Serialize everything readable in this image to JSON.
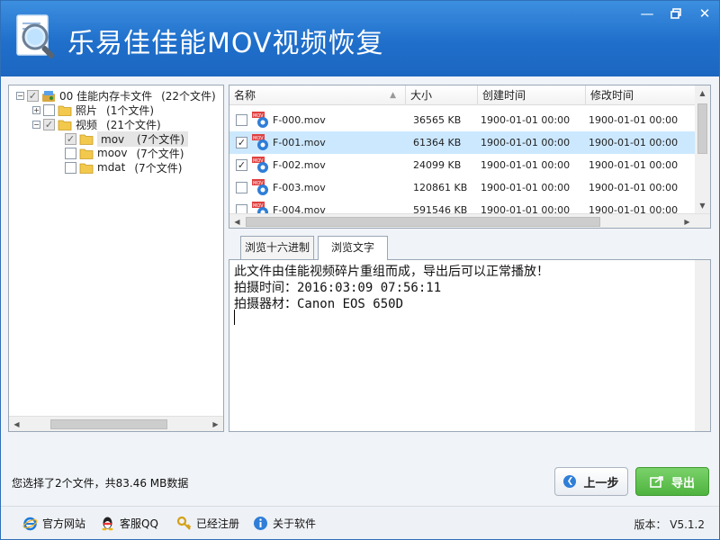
{
  "window": {
    "title": "乐易佳佳能MOV视频恢复",
    "controls": [
      "minimize-icon",
      "restore-icon",
      "close-icon"
    ]
  },
  "tree": {
    "root": {
      "label": "00  佳能内存卡文件",
      "count": "(22个文件)"
    },
    "photos": {
      "label": "照片",
      "count": "(1个文件)"
    },
    "videos": {
      "label": "视频",
      "count": "(21个文件)"
    },
    "mov": {
      "label": "mov",
      "count": "(7个文件)"
    },
    "moov": {
      "label": "moov",
      "count": "(7个文件)"
    },
    "mdat": {
      "label": "mdat",
      "count": "(7个文件)"
    }
  },
  "filelist": {
    "headers": {
      "name": "名称",
      "size": "大小",
      "created": "创建时间",
      "modified": "修改时间"
    },
    "rows": [
      {
        "name": "F-000.mov",
        "size": "36565 KB",
        "created": "1900-01-01  00:00",
        "modified": "1900-01-01  00:00",
        "checked": false
      },
      {
        "name": "F-001.mov",
        "size": "61364 KB",
        "created": "1900-01-01  00:00",
        "modified": "1900-01-01  00:00",
        "checked": true
      },
      {
        "name": "F-002.mov",
        "size": "24099 KB",
        "created": "1900-01-01  00:00",
        "modified": "1900-01-01  00:00",
        "checked": true
      },
      {
        "name": "F-003.mov",
        "size": "120861 KB",
        "created": "1900-01-01  00:00",
        "modified": "1900-01-01  00:00",
        "checked": false
      },
      {
        "name": "F-004.mov",
        "size": "591546 KB",
        "created": "1900-01-01  00:00",
        "modified": "1900-01-01  00:00",
        "checked": false
      }
    ]
  },
  "tabs": {
    "hex": "浏览十六进制",
    "text": "浏览文字"
  },
  "textview": {
    "line1": "此文件由佳能视频碎片重组而成，导出后可以正常播放！",
    "line2": "拍摄时间：2016:03:09 07:56:11",
    "line3": "拍摄器材：Canon EOS 650D"
  },
  "status": "您选择了2个文件，共83.46 MB数据",
  "buttons": {
    "prev": "上一步",
    "export": "导出"
  },
  "footer": {
    "website": "官方网站",
    "qq": "客服QQ",
    "registered": "已经注册",
    "about": "关于软件",
    "version": "版本： V5.1.2"
  },
  "colors": {
    "titlebar": "#1f6fcb",
    "selected_row": "#cce8ff",
    "export_button": "#4fb33f"
  }
}
